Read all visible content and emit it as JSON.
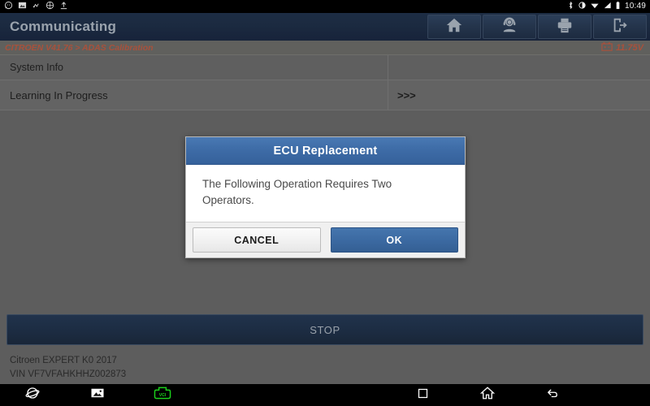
{
  "status_bar": {
    "left_icons": [
      "message-icon",
      "image-icon",
      "usb-icon",
      "settings-icon",
      "upload-icon"
    ],
    "right_icons": [
      "bluetooth-icon",
      "brightness-icon",
      "wifi-icon",
      "signal-icon",
      "battery-icon"
    ],
    "clock": "10:49"
  },
  "titlebar": {
    "app_title": "Communicating",
    "toolbar_buttons": [
      {
        "name": "home-button",
        "icon": "home-icon"
      },
      {
        "name": "support-button",
        "icon": "headset-person-icon"
      },
      {
        "name": "print-button",
        "icon": "printer-icon"
      },
      {
        "name": "exit-button",
        "icon": "exit-icon"
      }
    ]
  },
  "breadcrumb": {
    "path": "CITROEN V41.76 > ADAS Calibration",
    "voltage": "11.75V",
    "voltage_icon": "car-battery-icon",
    "accent_color": "#a8513c"
  },
  "table": {
    "header": {
      "left": "System Info",
      "right": ""
    },
    "rows": [
      {
        "left": "Learning In Progress",
        "right": ">>>"
      }
    ]
  },
  "stop_button": {
    "label": "STOP"
  },
  "footer": {
    "vehicle": "Citroen EXPERT K0 2017",
    "vin": "VIN VF7VFAHKHHZ002873"
  },
  "navbar": {
    "items": [
      {
        "name": "browser-icon"
      },
      {
        "name": "gallery-icon"
      },
      {
        "name": "vci-icon",
        "label": "VCI",
        "color": "#1bd11b"
      },
      {
        "name": "recents-icon"
      },
      {
        "name": "home-icon"
      },
      {
        "name": "back-icon"
      }
    ]
  },
  "dialog": {
    "title": "ECU Replacement",
    "message": "The Following Operation Requires Two Operators.",
    "cancel_label": "CANCEL",
    "ok_label": "OK",
    "accent_color": "#3c6aa2"
  }
}
